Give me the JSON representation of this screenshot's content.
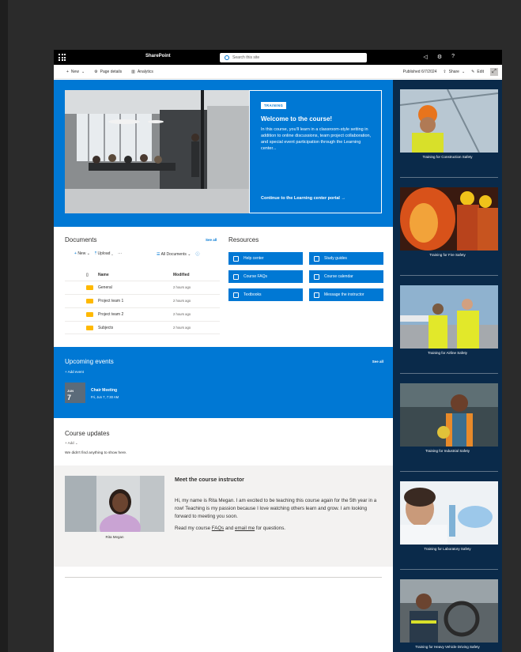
{
  "suite": {
    "brand": "SharePoint",
    "search_placeholder": "Search this site",
    "icons": [
      "megaphone-icon",
      "gear-icon",
      "help-icon"
    ],
    "help_glyph": "?"
  },
  "command_bar": {
    "new_label": "New",
    "page_details_label": "Page details",
    "analytics_label": "Analytics",
    "published": "Published 6/7/2024",
    "share_label": "Share",
    "edit_label": "Edit"
  },
  "hero": {
    "badge": "TRAINING",
    "title": "Welcome to the course!",
    "description": "In this course, you'll learn in a classroom-style setting in addition to online discussions, team project collaboration, and special event participation through the Learning center...",
    "link": "Continue to the Learning center portal →"
  },
  "documents": {
    "title": "Documents",
    "see_all": "See all",
    "toolbar": {
      "new": "New",
      "upload": "Upload",
      "more": "···",
      "view": "All Documents"
    },
    "columns": {
      "name": "Name",
      "modified": "Modified"
    },
    "rows": [
      {
        "name": "General",
        "modified": "2 hours ago"
      },
      {
        "name": "Project team 1",
        "modified": "2 hours ago"
      },
      {
        "name": "Project team 2",
        "modified": "2 hours ago"
      },
      {
        "name": "Subjects",
        "modified": "2 hours ago"
      }
    ]
  },
  "resources": {
    "title": "Resources",
    "items": [
      "Help center",
      "Study guides",
      "Course FAQs",
      "Course calendar",
      "Textbooks",
      "Message the instructor"
    ]
  },
  "events": {
    "title": "Upcoming events",
    "see_all": "See all",
    "add": "Add event",
    "item": {
      "month": "JUN",
      "day": "7",
      "name": "Chair Meeting",
      "time": "Fri, Jun 7, 7:30 AM"
    }
  },
  "course_updates": {
    "title": "Course updates",
    "add": "Add",
    "empty": "We didn't find anything to show here."
  },
  "instructor": {
    "photo_caption": "Rita Megan",
    "title": "Meet the course instructor",
    "bio": "Hi, my name is Rita Megan. I am excited to be teaching this course again for the 5th year in a row! Teaching is my passion because I love watching others learn and grow. I am looking forward to meeting you soon.",
    "read_prefix": "Read my course ",
    "faqs_link": "FAQs",
    "read_middle": " and ",
    "email_link": "email me",
    "read_suffix": " for questions."
  },
  "sidebar": {
    "items": [
      "Training for Construction Safety",
      "Training for Fire Safety",
      "Training for Airline Safety",
      "Training for Industrial Safety",
      "Training for Laboratory Safety",
      "Training for Heavy Vehicle Driving Safety"
    ]
  },
  "colors": {
    "accent": "#0078d4",
    "sidebar": "#0a2a4a",
    "page_bg": "#2b2b2b"
  }
}
